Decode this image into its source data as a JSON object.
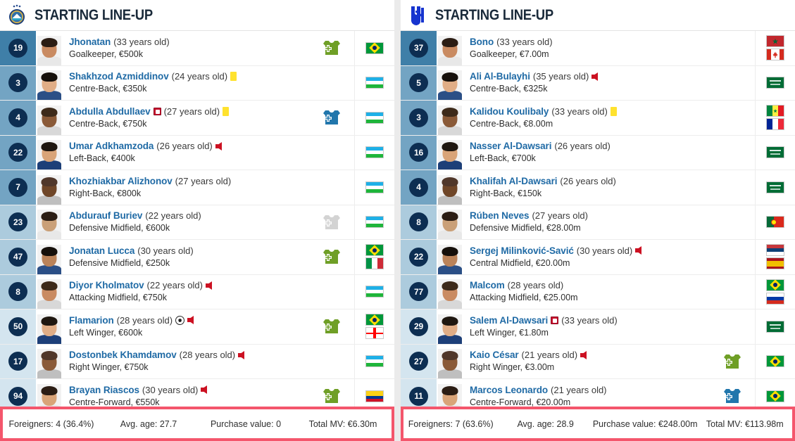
{
  "left": {
    "club": "al-vahdat-crest",
    "title": "STARTING LINE-UP",
    "players": [
      {
        "number": "19",
        "name": "Jhonatan",
        "age": "(33 years old)",
        "position": "Goalkeeper, €500k",
        "markers": [],
        "sub": "green",
        "flags": [
          "brazil"
        ],
        "tier": "gk"
      },
      {
        "number": "3",
        "name": "Shakhzod Azmiddinov",
        "age": "(24 years old)",
        "position": "Centre-Back, €350k",
        "markers": [
          "ycard"
        ],
        "sub": "none",
        "flags": [
          "uzbekistan"
        ],
        "tier": "def"
      },
      {
        "number": "4",
        "name": "Abdulla Abdullaev",
        "age": "(27 years old)",
        "position": "Centre-Back, €750k",
        "markers": [
          "captain-before",
          "ycard"
        ],
        "sub": "blue",
        "flags": [
          "uzbekistan"
        ],
        "tier": "def"
      },
      {
        "number": "22",
        "name": "Umar Adkhamzoda",
        "age": "(26 years old)",
        "position": "Left-Back, €400k",
        "markers": [
          "subout"
        ],
        "sub": "none",
        "flags": [
          "uzbekistan"
        ],
        "tier": "def"
      },
      {
        "number": "7",
        "name": "Khozhiakbar Alizhonov",
        "age": "(27 years old)",
        "position": "Right-Back, €800k",
        "markers": [],
        "sub": "none",
        "flags": [
          "uzbekistan"
        ],
        "tier": "def"
      },
      {
        "number": "23",
        "name": "Abdurauf Buriev",
        "age": "(22 years old)",
        "position": "Defensive Midfield, €600k",
        "markers": [],
        "sub": "grey",
        "flags": [
          "uzbekistan"
        ],
        "tier": "mid"
      },
      {
        "number": "47",
        "name": "Jonatan Lucca",
        "age": "(30 years old)",
        "position": "Defensive Midfield, €250k",
        "markers": [],
        "sub": "green",
        "flags": [
          "brazil",
          "italy"
        ],
        "tier": "mid"
      },
      {
        "number": "8",
        "name": "Diyor Kholmatov",
        "age": "(22 years old)",
        "position": "Attacking Midfield, €750k",
        "markers": [
          "subout"
        ],
        "sub": "none",
        "flags": [
          "uzbekistan"
        ],
        "tier": "mid"
      },
      {
        "number": "50",
        "name": "Flamarion",
        "age": "(28 years old)",
        "position": "Left Winger, €600k",
        "markers": [
          "goal",
          "subout"
        ],
        "sub": "green",
        "flags": [
          "brazil",
          "georgia"
        ],
        "tier": "att"
      },
      {
        "number": "17",
        "name": "Dostonbek Khamdamov",
        "age": "(28 years old)",
        "position": "Right Winger, €750k",
        "markers": [
          "subout"
        ],
        "sub": "none",
        "flags": [
          "uzbekistan"
        ],
        "tier": "att"
      },
      {
        "number": "94",
        "name": "Brayan Riascos",
        "age": "(30 years old)",
        "position": "Centre-Forward, €550k",
        "markers": [
          "subout"
        ],
        "sub": "green",
        "flags": [
          "colombia"
        ],
        "tier": "att"
      }
    ],
    "footer": {
      "foreigners": "Foreigners: 4 (36.4%)",
      "avg_age": "Avg. age: 27.7",
      "purchase_value": "Purchase value: 0",
      "total_mv": "Total MV: €6.30m"
    }
  },
  "right": {
    "club": "al-hilal-crest",
    "title": "STARTING LINE-UP",
    "players": [
      {
        "number": "37",
        "name": "Bono",
        "age": "(33 years old)",
        "position": "Goalkeeper, €7.00m",
        "markers": [],
        "sub": "none",
        "flags": [
          "morocco",
          "canada"
        ],
        "tier": "gk"
      },
      {
        "number": "5",
        "name": "Ali Al-Bulayhi",
        "age": "(35 years old)",
        "position": "Centre-Back, €325k",
        "markers": [
          "subout"
        ],
        "sub": "none",
        "flags": [
          "saudi"
        ],
        "tier": "def"
      },
      {
        "number": "3",
        "name": "Kalidou Koulibaly",
        "age": "(33 years old)",
        "position": "Centre-Back, €8.00m",
        "markers": [
          "ycard"
        ],
        "sub": "none",
        "flags": [
          "senegal",
          "france"
        ],
        "tier": "def"
      },
      {
        "number": "16",
        "name": "Nasser Al-Dawsari",
        "age": "(26 years old)",
        "position": "Left-Back, €700k",
        "markers": [],
        "sub": "none",
        "flags": [
          "saudi"
        ],
        "tier": "def"
      },
      {
        "number": "4",
        "name": "Khalifah Al-Dawsari",
        "age": "(26 years old)",
        "position": "Right-Back, €150k",
        "markers": [],
        "sub": "none",
        "flags": [
          "saudi"
        ],
        "tier": "def"
      },
      {
        "number": "8",
        "name": "Rúben Neves",
        "age": "(27 years old)",
        "position": "Defensive Midfield, €28.00m",
        "markers": [],
        "sub": "none",
        "flags": [
          "portugal"
        ],
        "tier": "mid"
      },
      {
        "number": "22",
        "name": "Sergej Milinković-Savić",
        "age": "(30 years old)",
        "position": "Central Midfield, €20.00m",
        "markers": [
          "subout"
        ],
        "sub": "none",
        "flags": [
          "serbia",
          "spain"
        ],
        "tier": "mid"
      },
      {
        "number": "77",
        "name": "Malcom",
        "age": "(28 years old)",
        "position": "Attacking Midfield, €25.00m",
        "markers": [],
        "sub": "none",
        "flags": [
          "brazil",
          "russia"
        ],
        "tier": "mid"
      },
      {
        "number": "29",
        "name": "Salem Al-Dawsari",
        "age": "(33 years old)",
        "position": "Left Winger, €1.80m",
        "markers": [
          "captain-before"
        ],
        "sub": "none",
        "flags": [
          "saudi"
        ],
        "tier": "att"
      },
      {
        "number": "27",
        "name": "Kaio César",
        "age": "(21 years old)",
        "position": "Right Winger, €3.00m",
        "markers": [
          "subout"
        ],
        "sub": "green",
        "flags": [
          "brazil"
        ],
        "tier": "att"
      },
      {
        "number": "11",
        "name": "Marcos Leonardo",
        "age": "(21 years old)",
        "position": "Centre-Forward, €20.00m",
        "markers": [],
        "sub": "blue",
        "flags": [
          "brazil"
        ],
        "tier": "att"
      }
    ],
    "footer": {
      "foreigners": "Foreigners: 7 (63.6%)",
      "avg_age": "Avg. age: 28.9",
      "purchase_value": "Purchase value: €248.00m",
      "total_mv": "Total MV: €113.98m"
    }
  },
  "colors": {
    "name_link": "#1f6aa5",
    "number_badge": "#0d2e52",
    "tier_gk": "#3f7fa8",
    "tier_def": "#73a4c3",
    "tier_mid": "#accbdd",
    "tier_att": "#d4e5ef",
    "sub_in_green": "#6f9f26",
    "sub_in_blue": "#2176ac",
    "sub_in_grey": "#d3d3d3",
    "highlight_border": "#f4566c",
    "yellow_card": "#ffe22e",
    "sub_out_arrow": "#cc1122"
  }
}
